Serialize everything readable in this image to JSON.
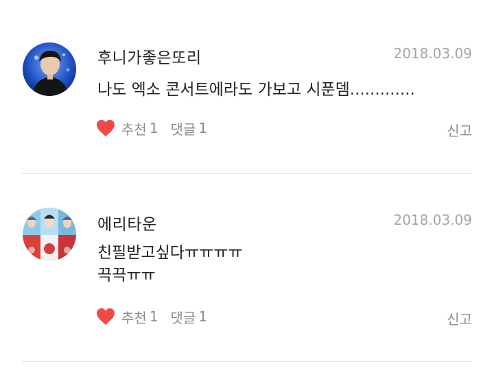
{
  "comments": [
    {
      "username": "후니가좋은또리",
      "date": "2018.03.09",
      "body_lines": [
        "나도 엑소 콘서트에라도 가보고 시푼뎀............."
      ],
      "like_label": "추천",
      "like_count": "1",
      "reply_label": "댓글",
      "reply_count": "1",
      "report_label": "신고",
      "heart_color": "#ee4a4a"
    },
    {
      "username": "에리타운",
      "date": "2018.03.09",
      "body_lines": [
        "친필받고싶다ㅠㅠㅠㅠ",
        "끅끅ㅠㅠ"
      ],
      "like_label": "추천",
      "like_count": "1",
      "reply_label": "댓글",
      "reply_count": "1",
      "report_label": "신고",
      "heart_color": "#ee4a4a"
    }
  ]
}
